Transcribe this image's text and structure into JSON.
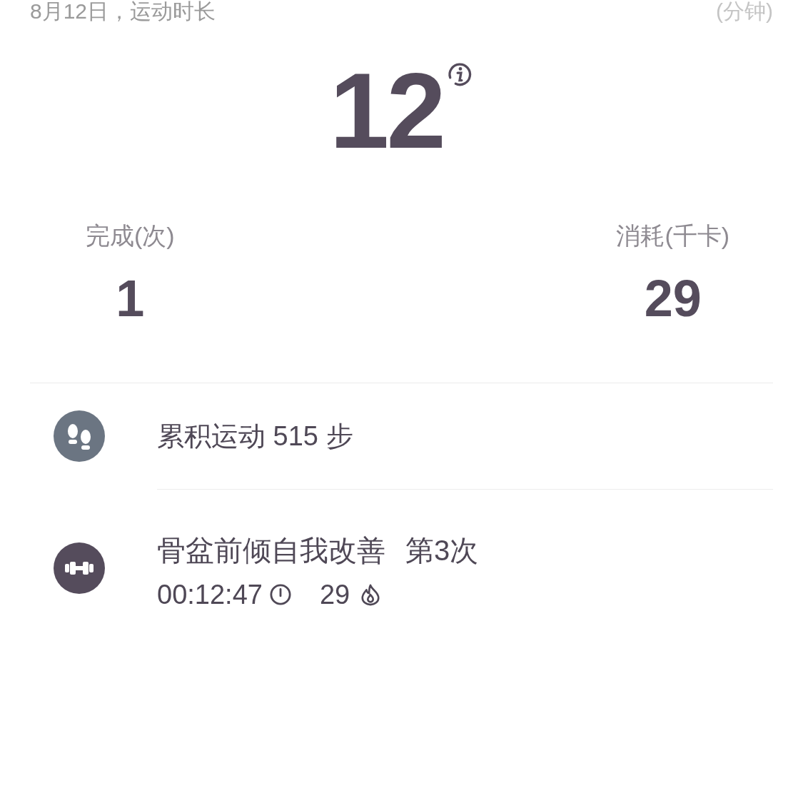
{
  "header": {
    "date_label": "8月12日，运动时长",
    "unit": "(分钟)"
  },
  "duration": "12",
  "stats": [
    {
      "label": "完成(次)",
      "value": "1"
    },
    {
      "label": "消耗(千卡)",
      "value": "29"
    }
  ],
  "records": [
    {
      "kind": "steps",
      "title": "累积运动 515 步"
    },
    {
      "kind": "workout",
      "title": "骨盆前倾自我改善",
      "count": "第3次",
      "time": "00:12:47",
      "calories": "29"
    }
  ]
}
